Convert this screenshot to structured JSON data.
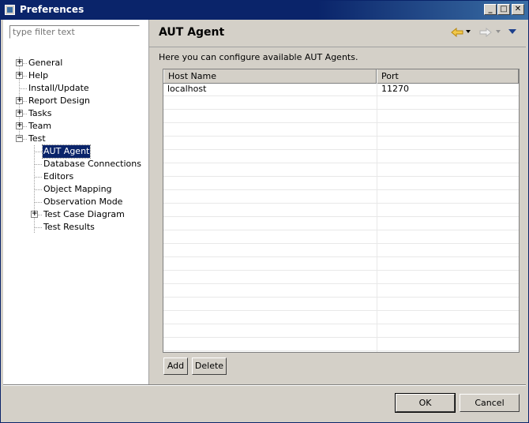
{
  "window": {
    "title": "Preferences"
  },
  "filter": {
    "placeholder": "type filter text"
  },
  "tree": {
    "general": "General",
    "help": "Help",
    "install_update": "Install/Update",
    "report_design": "Report Design",
    "tasks": "Tasks",
    "team": "Team",
    "test": "Test",
    "aut_agent": "AUT Agent",
    "database_connections": "Database Connections",
    "editors": "Editors",
    "object_mapping": "Object Mapping",
    "observation_mode": "Observation Mode",
    "test_case_diagram": "Test Case Diagram",
    "test_results": "Test Results"
  },
  "page": {
    "title": "AUT Agent",
    "description": "Here you can configure available AUT Agents."
  },
  "table": {
    "columns": [
      "Host Name",
      "Port"
    ],
    "rows": [
      [
        "localhost",
        "11270"
      ]
    ]
  },
  "buttons": {
    "add": "Add",
    "delete": "Delete",
    "ok": "OK",
    "cancel": "Cancel"
  },
  "colors": {
    "titlebar": "#0a246a",
    "selection": "#0a246a",
    "dialog_bg": "#d4d0c8"
  },
  "icons": {
    "back": "back-arrow-icon",
    "forward": "forward-arrow-icon",
    "menu": "view-menu-icon"
  }
}
